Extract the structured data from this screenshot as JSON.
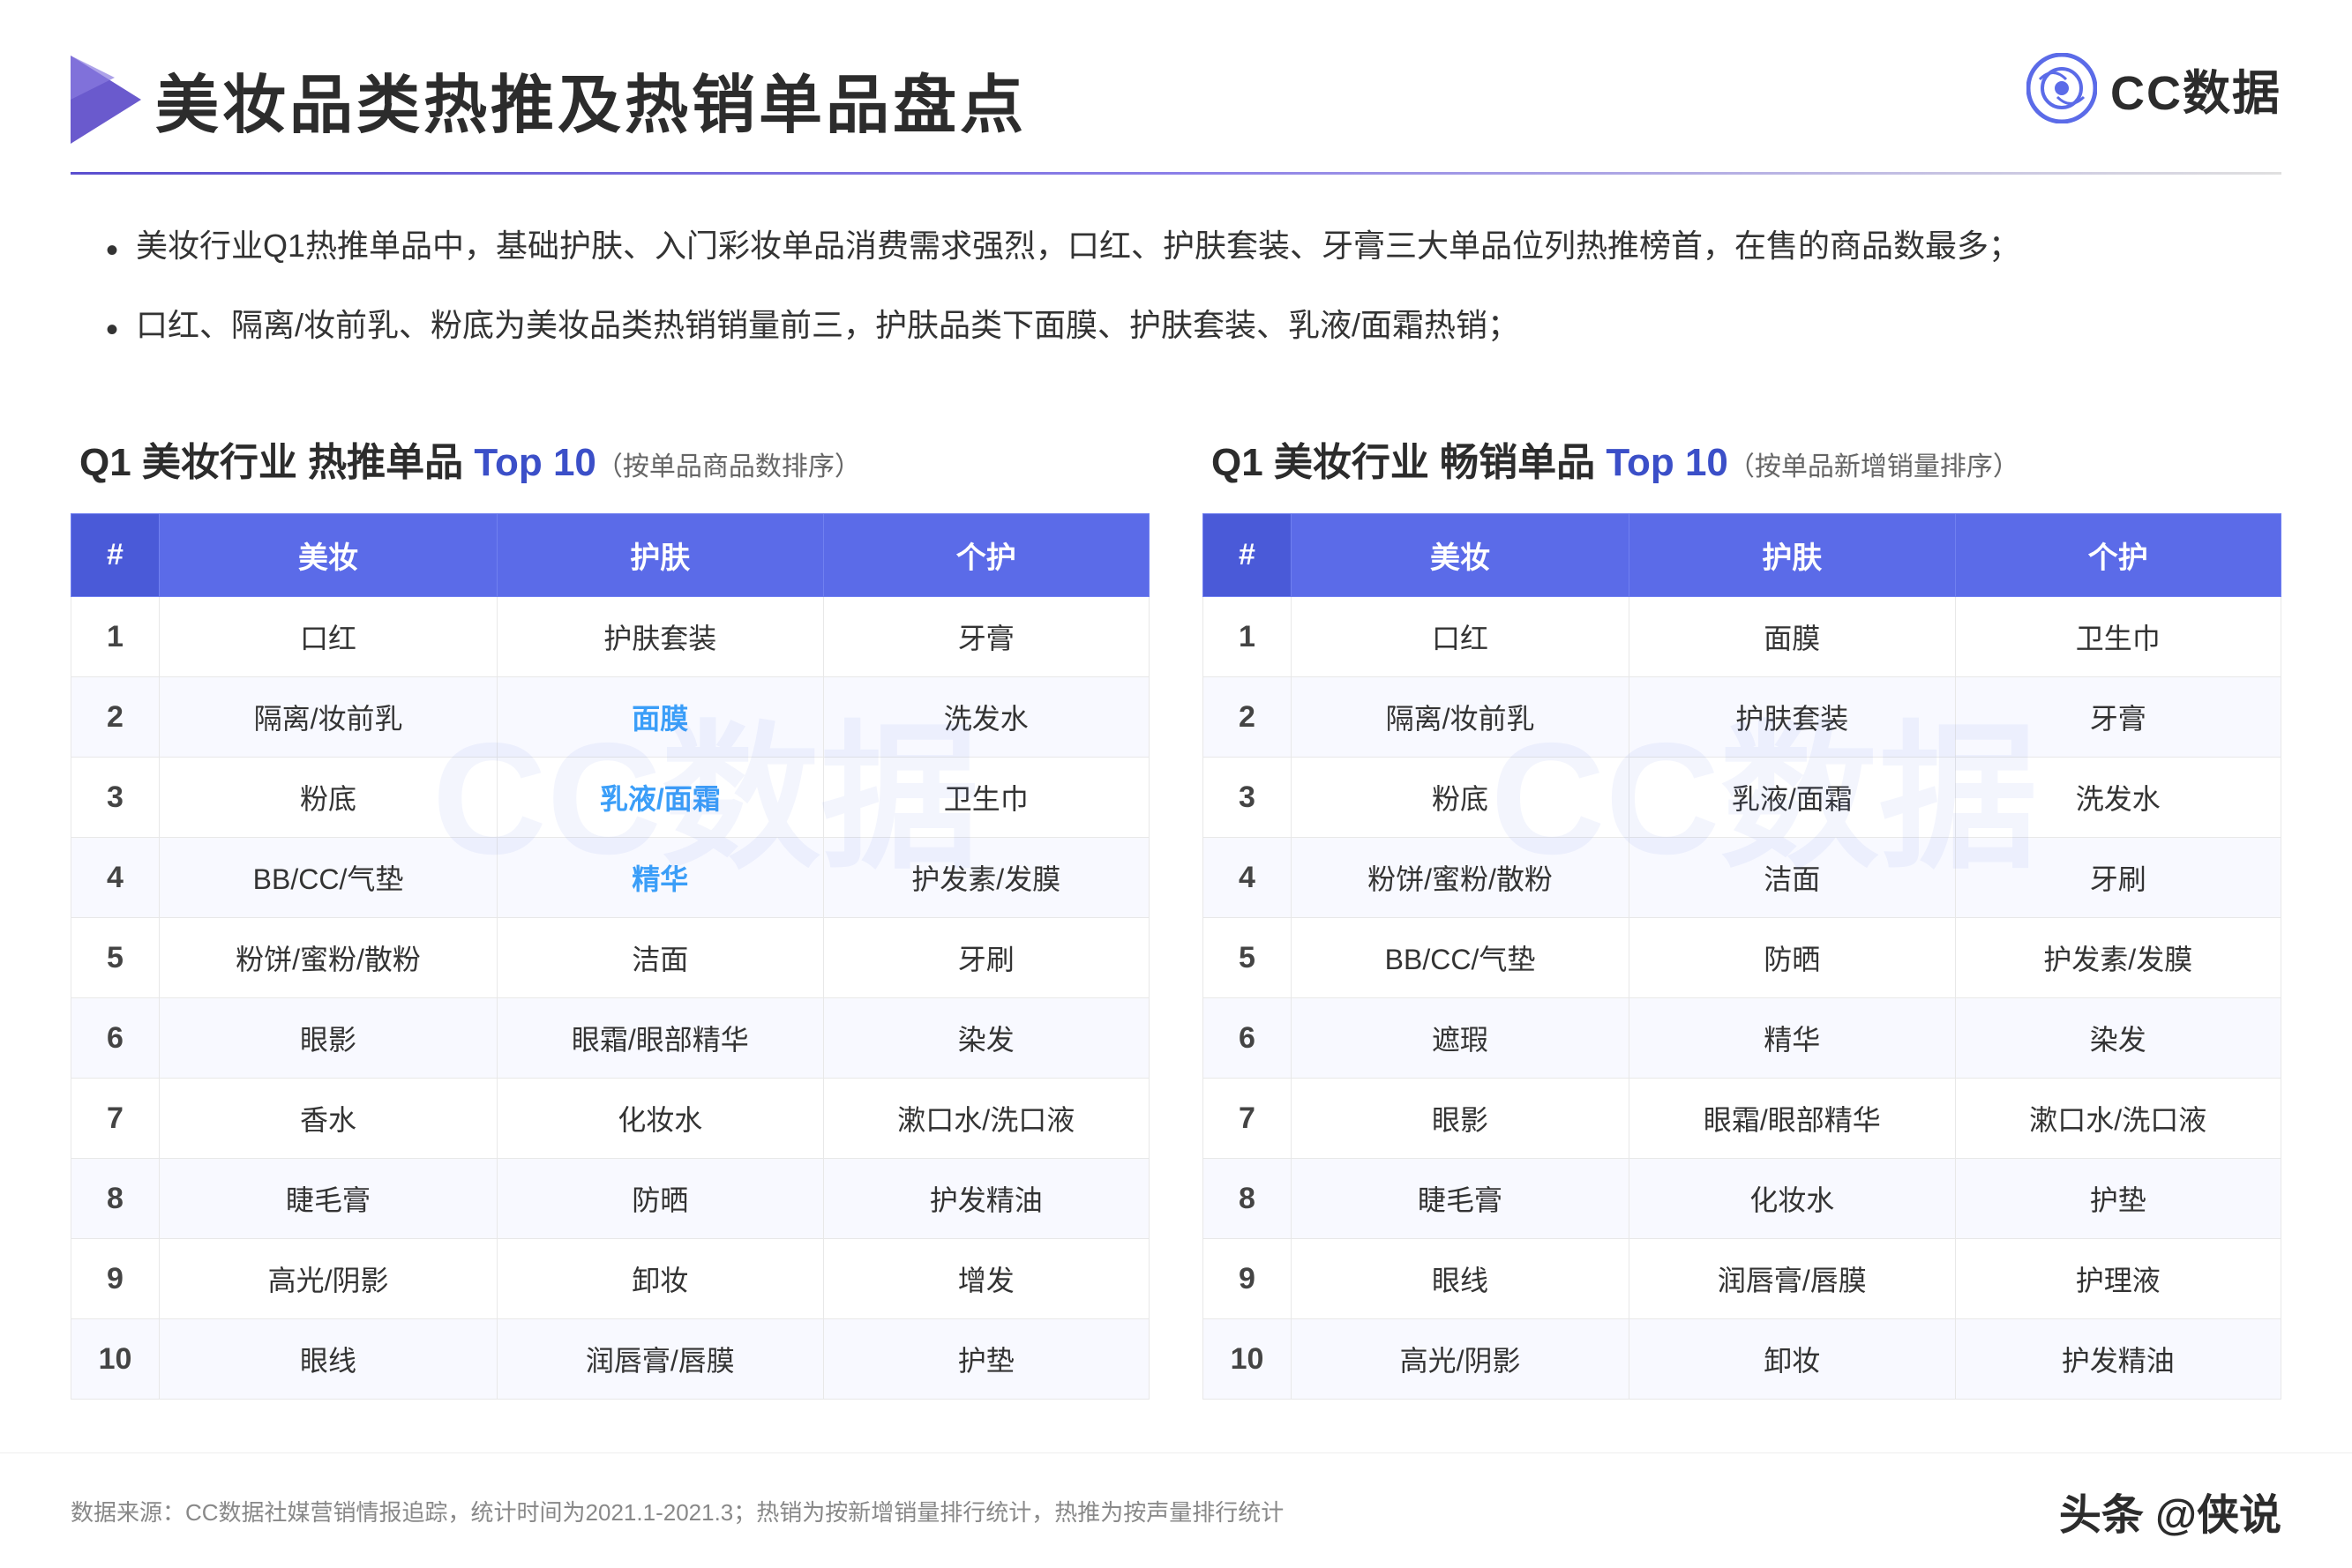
{
  "logo": {
    "text": "CC数据",
    "icon_label": "cc-data-logo"
  },
  "header": {
    "title": "美妆品类热推及热销单品盘点"
  },
  "bullets": [
    "美妆行业Q1热推单品中，基础护肤、入门彩妆单品消费需求强烈，口红、护肤套装、牙膏三大单品位列热推榜首，在售的商品数最多；",
    "口红、隔离/妆前乳、粉底为美妆品类热销销量前三，护肤品类下面膜、护肤套装、乳液/面霜热销；"
  ],
  "table1": {
    "title_prefix": "Q1 美妆行业 热推单品 ",
    "title_top": "Top",
    "title_number": "10",
    "title_suffix": "（按单品商品数排序）",
    "columns": [
      "#",
      "美妆",
      "护肤",
      "个护"
    ],
    "rows": [
      {
        "rank": "1",
        "meizhuang": "口红",
        "hufu": "护肤套装",
        "geh": "牙膏"
      },
      {
        "rank": "2",
        "meizhuang": "隔离/妆前乳",
        "hufu": "面膜",
        "geh": "洗发水",
        "hufu_highlight": true
      },
      {
        "rank": "3",
        "meizhuang": "粉底",
        "hufu": "乳液/面霜",
        "geh": "卫生巾",
        "hufu_highlight": true
      },
      {
        "rank": "4",
        "meizhuang": "BB/CC/气垫",
        "hufu": "精华",
        "geh": "护发素/发膜",
        "hufu_highlight": true
      },
      {
        "rank": "5",
        "meizhuang": "粉饼/蜜粉/散粉",
        "hufu": "洁面",
        "geh": "牙刷"
      },
      {
        "rank": "6",
        "meizhuang": "眼影",
        "hufu": "眼霜/眼部精华",
        "geh": "染发"
      },
      {
        "rank": "7",
        "meizhuang": "香水",
        "hufu": "化妆水",
        "geh": "漱口水/洗口液"
      },
      {
        "rank": "8",
        "meizhuang": "睫毛膏",
        "hufu": "防晒",
        "geh": "护发精油"
      },
      {
        "rank": "9",
        "meizhuang": "高光/阴影",
        "hufu": "卸妆",
        "geh": "增发"
      },
      {
        "rank": "10",
        "meizhuang": "眼线",
        "hufu": "润唇膏/唇膜",
        "geh": "护垫"
      }
    ]
  },
  "table2": {
    "title_prefix": "Q1 美妆行业 畅销单品 ",
    "title_top": "Top",
    "title_number": "10",
    "title_suffix": "（按单品新增销量排序）",
    "columns": [
      "#",
      "美妆",
      "护肤",
      "个护"
    ],
    "rows": [
      {
        "rank": "1",
        "meizhuang": "口红",
        "hufu": "面膜",
        "geh": "卫生巾"
      },
      {
        "rank": "2",
        "meizhuang": "隔离/妆前乳",
        "hufu": "护肤套装",
        "geh": "牙膏"
      },
      {
        "rank": "3",
        "meizhuang": "粉底",
        "hufu": "乳液/面霜",
        "geh": "洗发水"
      },
      {
        "rank": "4",
        "meizhuang": "粉饼/蜜粉/散粉",
        "hufu": "洁面",
        "geh": "牙刷"
      },
      {
        "rank": "5",
        "meizhuang": "BB/CC/气垫",
        "hufu": "防晒",
        "geh": "护发素/发膜"
      },
      {
        "rank": "6",
        "meizhuang": "遮瑕",
        "hufu": "精华",
        "geh": "染发"
      },
      {
        "rank": "7",
        "meizhuang": "眼影",
        "hufu": "眼霜/眼部精华",
        "geh": "漱口水/洗口液"
      },
      {
        "rank": "8",
        "meizhuang": "睫毛膏",
        "hufu": "化妆水",
        "geh": "护垫"
      },
      {
        "rank": "9",
        "meizhuang": "眼线",
        "hufu": "润唇膏/唇膜",
        "geh": "护理液"
      },
      {
        "rank": "10",
        "meizhuang": "高光/阴影",
        "hufu": "卸妆",
        "geh": "护发精油"
      }
    ]
  },
  "footer": {
    "source_text": "数据来源：CC数据社媒营销情报追踪，统计时间为2021.1-2021.3；热销为按新增销量排行统计，热推为按声量排行统计",
    "footer_logo": "头条 @侠说"
  },
  "watermark": "CC数据"
}
